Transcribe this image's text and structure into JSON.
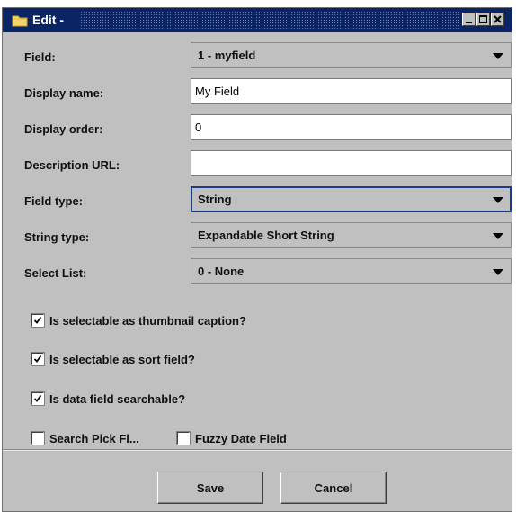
{
  "window": {
    "title": "Edit -"
  },
  "form": {
    "field": {
      "label": "Field:",
      "value": "1 - myfield"
    },
    "display_name": {
      "label": "Display name:",
      "value": "My Field"
    },
    "display_order": {
      "label": "Display order:",
      "value": "0"
    },
    "description_url": {
      "label": "Description URL:",
      "value": ""
    },
    "field_type": {
      "label": "Field type:",
      "value": "String"
    },
    "string_type": {
      "label": "String type:",
      "value": "Expandable Short String"
    },
    "select_list": {
      "label": "Select List:",
      "value": "0 - None"
    }
  },
  "checkboxes": {
    "thumbnail_caption": {
      "label": "Is selectable as thumbnail caption?",
      "checked": true
    },
    "sort_field": {
      "label": "Is selectable as sort field?",
      "checked": true
    },
    "searchable": {
      "label": "Is data field searchable?",
      "checked": true
    },
    "search_pick": {
      "label": "Search Pick Fi...",
      "checked": false
    },
    "fuzzy_date": {
      "label": "Fuzzy Date Field",
      "checked": false
    }
  },
  "buttons": {
    "save": "Save",
    "cancel": "Cancel"
  },
  "icons": {
    "title": "folder-icon",
    "minimize": "minimize-icon",
    "maximize": "maximize-icon",
    "close": "close-icon",
    "dropdown": "chevron-down-icon",
    "check": "checkmark-icon"
  },
  "colors": {
    "titlebar": "#0b2463",
    "panel": "#c0c0c0",
    "focus": "#1e3a8a"
  }
}
